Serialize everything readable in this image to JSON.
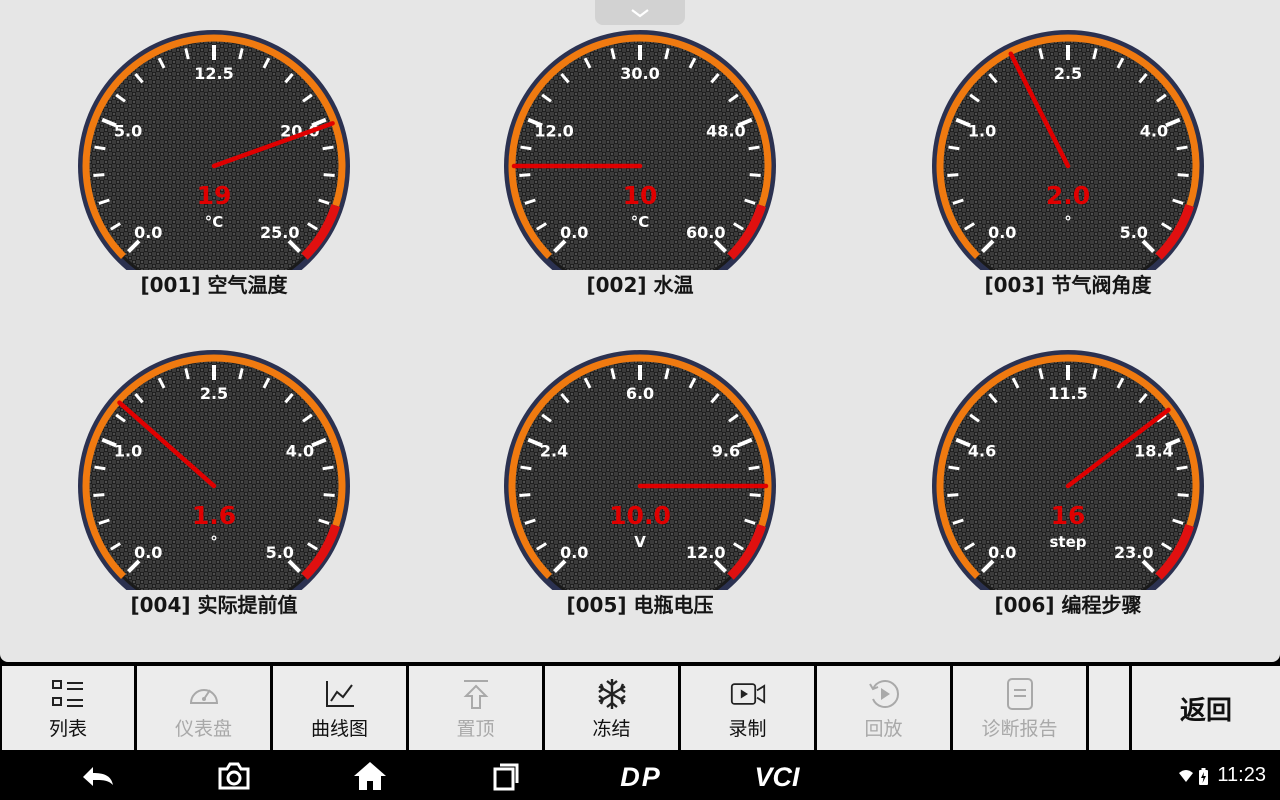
{
  "gauges": [
    {
      "label": "[001] 空气温度",
      "value": 19,
      "value_text": "19",
      "unit": "°C",
      "min": 0,
      "max": 25,
      "ticks": [
        "0.0",
        "5.0",
        "12.5",
        "20.0",
        "25.0"
      ]
    },
    {
      "label": "[002] 水温",
      "value": 10,
      "value_text": "10",
      "unit": "°C",
      "min": 0,
      "max": 60,
      "ticks": [
        "0.0",
        "12.0",
        "30.0",
        "48.0",
        "60.0"
      ]
    },
    {
      "label": "[003] 节气阀角度",
      "value": 2.0,
      "value_text": "2.0",
      "unit": "°",
      "min": 0,
      "max": 5,
      "ticks": [
        "0.0",
        "1.0",
        "2.5",
        "4.0",
        "5.0"
      ]
    },
    {
      "label": "[004] 实际提前值",
      "value": 1.6,
      "value_text": "1.6",
      "unit": "°",
      "min": 0,
      "max": 5,
      "ticks": [
        "0.0",
        "1.0",
        "2.5",
        "4.0",
        "5.0"
      ]
    },
    {
      "label": "[005] 电瓶电压",
      "value": 10.0,
      "value_text": "10.0",
      "unit": "V",
      "min": 0,
      "max": 12,
      "ticks": [
        "0.0",
        "2.4",
        "6.0",
        "9.6",
        "12.0"
      ]
    },
    {
      "label": "[006] 编程步骤",
      "value": 16,
      "value_text": "16",
      "unit": "step",
      "min": 0,
      "max": 23,
      "ticks": [
        "0.0",
        "4.6",
        "11.5",
        "18.4",
        "23.0"
      ]
    }
  ],
  "toolbar": [
    {
      "key": "list",
      "label": "列表",
      "icon": "list-icon",
      "enabled": true
    },
    {
      "key": "dashboard",
      "label": "仪表盘",
      "icon": "dashboard-icon",
      "enabled": false
    },
    {
      "key": "graph",
      "label": "曲线图",
      "icon": "line-chart-icon",
      "enabled": true
    },
    {
      "key": "pin",
      "label": "置顶",
      "icon": "pin-top-icon",
      "enabled": false
    },
    {
      "key": "freeze",
      "label": "冻结",
      "icon": "snowflake-icon",
      "enabled": true
    },
    {
      "key": "record",
      "label": "录制",
      "icon": "video-record-icon",
      "enabled": true
    },
    {
      "key": "playback",
      "label": "回放",
      "icon": "playback-icon",
      "enabled": false
    },
    {
      "key": "report",
      "label": "诊断报告",
      "icon": "report-icon",
      "enabled": false
    }
  ],
  "back_label": "返回",
  "status": {
    "time": "11:23"
  },
  "nav": {
    "dp_label": "DP",
    "vci_label": "VCI"
  },
  "colors": {
    "needle": "#e00000",
    "arc_orange": "#f07a10",
    "arc_red": "#e01010",
    "value_text": "#e00000",
    "face": "#2a2a2a",
    "bezel": "#2b3150"
  }
}
